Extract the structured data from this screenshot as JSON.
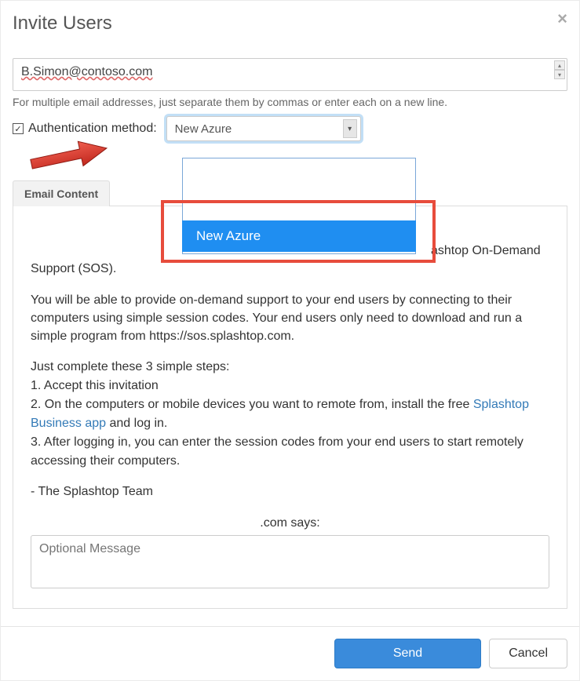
{
  "modal": {
    "title": "Invite Users",
    "close_label": "×"
  },
  "email_input": {
    "value": "B.Simon@contoso.com",
    "hint": "For multiple email addresses, just separate them by commas or enter each on a new line."
  },
  "auth": {
    "checkbox_checked": true,
    "label": "Authentication method:",
    "selected": "New Azure",
    "dropdown_option_highlighted": "New Azure"
  },
  "tabs": {
    "email_content": "Email Content"
  },
  "email_content": {
    "para1_suffix": "ashtop On-Demand Support (SOS).",
    "para2": "You will be able to provide on-demand support to your end users by connecting to their computers using simple session codes. Your end users only need to download and run a simple program from https://sos.splashtop.com.",
    "steps_intro": "Just complete these 3 simple steps:",
    "step1": "1. Accept this invitation",
    "step2_prefix": "2. On the computers or mobile devices you want to remote from, install the free ",
    "step2_link": "Splashtop Business app",
    "step2_suffix": " and log in.",
    "step3": "3. After logging in, you can enter the session codes from your end users to start remotely accessing their computers.",
    "signoff": "- The Splashtop Team",
    "says_text": ".com says:",
    "optional_placeholder": "Optional Message"
  },
  "footer": {
    "send": "Send",
    "cancel": "Cancel"
  }
}
